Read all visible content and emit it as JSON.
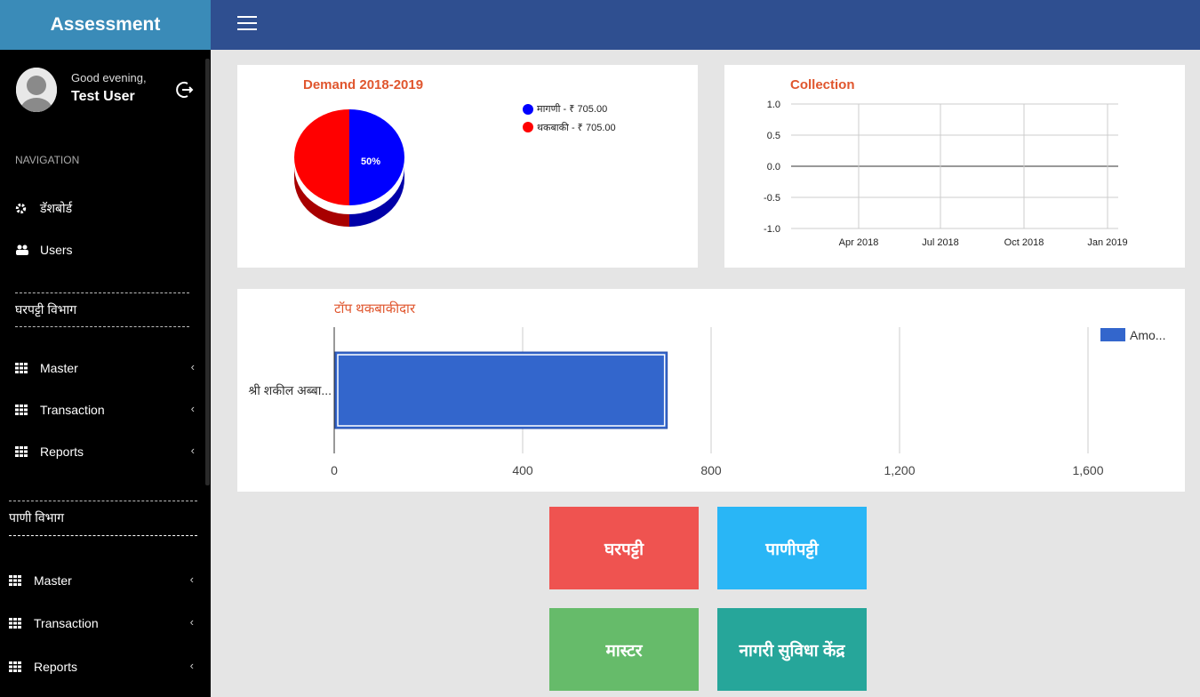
{
  "app": {
    "title": "Assessment"
  },
  "user": {
    "greeting": "Good evening,",
    "name": "Test User"
  },
  "nav": {
    "heading": "NAVIGATION",
    "items": [
      {
        "label": "डॅशबोर्ड",
        "icon": "gear-icon"
      },
      {
        "label": "Users",
        "icon": "users-icon"
      }
    ],
    "sections": [
      {
        "title": "घरपट्टी विभाग",
        "items": [
          "Master",
          "Transaction",
          "Reports"
        ]
      },
      {
        "title": "पाणी विभाग",
        "items": [
          "Master",
          "Transaction",
          "Reports"
        ]
      }
    ]
  },
  "colors": {
    "topbar": "#2f4f90",
    "brand": "#3a8bb8",
    "title": "#e0562e"
  },
  "demand": {
    "title": "Demand 2018-2019",
    "chart_data": {
      "type": "pie",
      "title": "Demand 2018-2019",
      "slices": [
        {
          "label": "मागणी - ₹ 705.00",
          "value": 705,
          "percent": "50%",
          "color": "#0000ff"
        },
        {
          "label": "थकबाकी - ₹ 705.00",
          "value": 705,
          "percent": "50%",
          "color": "#ff0000"
        }
      ]
    }
  },
  "collection": {
    "title": "Collection",
    "chart_data": {
      "type": "line",
      "title": "Collection",
      "x_ticks": [
        "Apr 2018",
        "Jul 2018",
        "Oct 2018",
        "Jan 2019"
      ],
      "y_ticks": [
        "1.0",
        "0.5",
        "0.0",
        "-0.5",
        "-1.0"
      ],
      "ylim": [
        -1,
        1
      ],
      "series": []
    }
  },
  "top_defaulters": {
    "title": "टॉप थकबाकीदार",
    "chart_data": {
      "type": "bar",
      "orientation": "horizontal",
      "categories": [
        "श्री शकील अब्बा..."
      ],
      "series": [
        {
          "name": "Amo...",
          "values": [
            705
          ],
          "color": "#3366cc"
        }
      ],
      "x_ticks": [
        "0",
        "400",
        "800",
        "1,200",
        "1,600"
      ],
      "xlim": [
        0,
        1700
      ]
    }
  },
  "tiles": [
    {
      "label": "घरपट्टी",
      "color": "#ef5350"
    },
    {
      "label": "पाणीपट्टी",
      "color": "#29b6f6"
    },
    {
      "label": "मास्टर",
      "color": "#66bb6a"
    },
    {
      "label": "नागरी सुविधा केंद्र",
      "color": "#26a69a"
    }
  ]
}
